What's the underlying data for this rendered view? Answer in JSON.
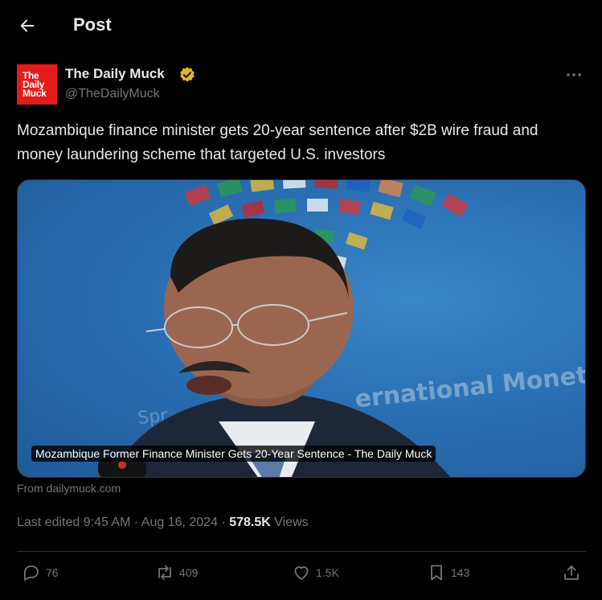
{
  "header": {
    "title": "Post",
    "back_icon": "arrow-left-icon"
  },
  "author": {
    "name": "The Daily Muck",
    "handle": "@TheDailyMuck",
    "logo_lines": [
      "The",
      "Daily",
      "Muck"
    ],
    "logo_color": "#e21b1b",
    "verified_color": "#e2b719"
  },
  "post": {
    "text": "Mozambique finance minister gets 20-year sentence after $2B wire fraud and money laundering scheme that targeted U.S. investors"
  },
  "card": {
    "caption": "Mozambique Former Finance Minister Gets 20-Year Sentence - The Daily Muck",
    "source": "From dailymuck.com"
  },
  "meta": {
    "edited": "Last edited 9:45 AM",
    "separator": "·",
    "date": "Aug 16, 2024",
    "views_count": "578.5K",
    "views_label": "Views"
  },
  "actions": {
    "replies": "76",
    "reposts": "409",
    "likes": "1.5K",
    "bookmarks": "143"
  },
  "colors": {
    "background": "#000000",
    "text": "#e7e9ea",
    "muted": "#71767b",
    "border": "#2f3336"
  }
}
